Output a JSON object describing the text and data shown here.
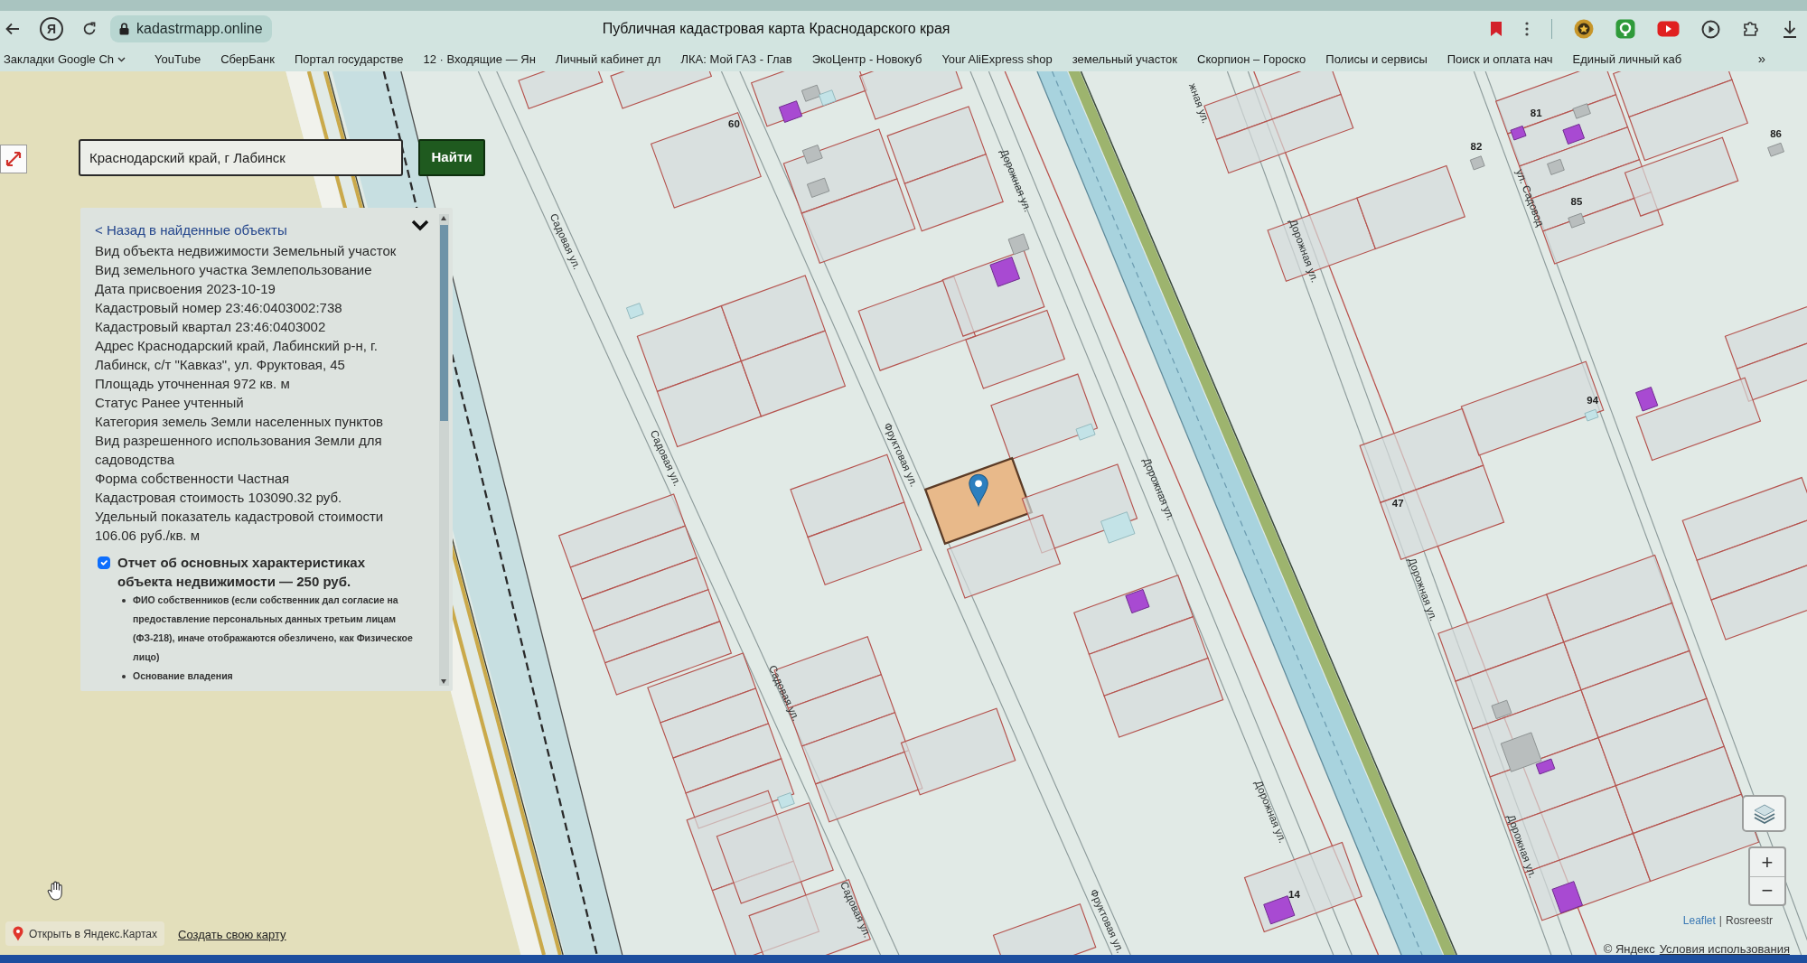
{
  "browser": {
    "logo_letter": "Я",
    "address": "kadastrmapp.online",
    "page_title": "Публичная кадастровая карта Краснодарского края"
  },
  "bookmarks": [
    {
      "label": "Закладки Google Ch",
      "kind": "folder"
    },
    {
      "label": "YouTube",
      "kind": "link"
    },
    {
      "label": "СберБанк",
      "kind": "link"
    },
    {
      "label": "Портал государстве",
      "kind": "link"
    },
    {
      "label": "12 · Входящие — Ян",
      "kind": "link"
    },
    {
      "label": "Личный кабинет дл",
      "kind": "link"
    },
    {
      "label": "ЛКА: Мой ГАЗ - Глав",
      "kind": "link"
    },
    {
      "label": "ЭкоЦентр - Новокуб",
      "kind": "link"
    },
    {
      "label": "Your AliExpress shop",
      "kind": "link"
    },
    {
      "label": "земельный участок",
      "kind": "link"
    },
    {
      "label": "Скорпион – Гороско",
      "kind": "link"
    },
    {
      "label": "Полисы и сервисы",
      "kind": "link"
    },
    {
      "label": "Поиск и оплата нач",
      "kind": "link"
    },
    {
      "label": "Единый личный каб",
      "kind": "link"
    }
  ],
  "bookmarks_more": "»",
  "search": {
    "value": "Краснодарский край, г Лабинск",
    "button": "Найти"
  },
  "info_panel": {
    "back_link": "< Назад в найденные объекты",
    "details": [
      "Вид объекта недвижимости Земельный участок",
      "Вид земельного участка Землепользование",
      "Дата присвоения 2023-10-19",
      "Кадастровый номер 23:46:0403002:738",
      "Кадастровый квартал 23:46:0403002",
      "Адрес Краснодарский край, Лабинский р-н, г. Лабинск, с/т \"Кавказ\", ул. Фруктовая, 45",
      "Площадь уточненная 972 кв. м",
      "Статус Ранее учтенный",
      "Категория земель Земли населенных пунктов",
      "Вид разрешенного использования Земли для садоводства",
      "Форма собственности Частная",
      "Кадастровая стоимость 103090.32 руб.",
      "Удельный показатель кадастровой стоимости 106.06 руб./кв. м"
    ],
    "report": {
      "checked": true,
      "title": "Отчет об основных характеристиках объекта недвижимости — 250 руб.",
      "items": [
        "ФИО собственников (если собственник дал согласие на предоставление персональных данных третьим лицам (ФЗ-218), иначе отображаются обезличено, как Физическое лицо)",
        "Основание владения"
      ]
    }
  },
  "map": {
    "street_labels": [
      "жная ул.",
      "Дорожная ул.",
      "ул. Садовод",
      "Садовая ул.",
      "Дорожная ул.",
      "Фруктовая ул.",
      "Садовая ул.",
      "Дорожная ул.",
      "Дорожная ул.",
      "Садовая ул.",
      "Дорожная ул.",
      "Дорожная ул.",
      "Садовая ул.",
      "Фруктовая ул."
    ],
    "house_numbers": [
      "81",
      "60",
      "86",
      "82",
      "85",
      "94",
      "47",
      "14"
    ],
    "parcels": [
      {
        "selected": false
      },
      {
        "selected": false
      },
      {
        "selected": false
      },
      {
        "selected": false
      },
      {
        "selected": false
      },
      {
        "selected": false
      },
      {
        "selected": false
      },
      {
        "selected": false
      },
      {
        "selected": false
      },
      {
        "selected": false
      },
      {
        "selected": false
      },
      {
        "selected": false
      },
      {
        "selected": false
      },
      {
        "selected": false
      },
      {
        "selected": false
      },
      {
        "selected": false
      },
      {
        "selected": false
      },
      {
        "selected": false
      },
      {
        "selected": false
      },
      {
        "selected": false
      },
      {
        "selected": false
      },
      {
        "selected": false
      },
      {
        "selected": false
      },
      {
        "selected": false
      },
      {
        "selected": false
      },
      {
        "selected": false
      },
      {
        "selected": false
      },
      {
        "selected": false
      },
      {
        "selected": false
      },
      {
        "selected": false
      },
      {
        "selected": false
      },
      {
        "selected": false
      },
      {
        "selected": false
      },
      {
        "selected": false
      },
      {
        "selected": false
      },
      {
        "selected": false
      },
      {
        "selected": false
      },
      {
        "selected": false
      },
      {
        "selected": true
      },
      {
        "selected": false
      },
      {
        "selected": false
      },
      {
        "selected": false
      },
      {
        "selected": false
      },
      {
        "selected": false
      },
      {
        "selected": false
      },
      {
        "selected": false
      },
      {
        "selected": false
      },
      {
        "selected": false
      },
      {
        "selected": false
      },
      {
        "selected": false
      },
      {
        "selected": false
      },
      {
        "selected": false
      },
      {
        "selected": false
      },
      {
        "selected": false
      },
      {
        "selected": false
      },
      {
        "selected": false
      },
      {
        "selected": false
      },
      {
        "selected": false
      },
      {
        "selected": false
      },
      {
        "selected": false
      },
      {
        "selected": false
      },
      {
        "selected": false
      },
      {
        "selected": false
      },
      {
        "selected": false
      },
      {
        "selected": false
      },
      {
        "selected": false
      },
      {
        "selected": false
      },
      {
        "selected": false
      },
      {
        "selected": false
      },
      {
        "selected": false
      },
      {
        "selected": false
      },
      {
        "selected": false
      },
      {
        "selected": false
      },
      {
        "selected": false
      },
      {
        "selected": false
      },
      {
        "selected": false
      },
      {
        "selected": false
      },
      {
        "selected": false
      }
    ]
  },
  "map_controls": {
    "zoom_in": "+",
    "zoom_out": "−"
  },
  "attribution": {
    "link": "Leaflet",
    "separator": "|",
    "source": "Rosreestr",
    "copyright": "© Яндекс",
    "terms_link": "Условия использования"
  },
  "footer_links": {
    "open_in_maps": "Открыть в Яндекс.Картах",
    "create_map": "Создать свою карту"
  }
}
